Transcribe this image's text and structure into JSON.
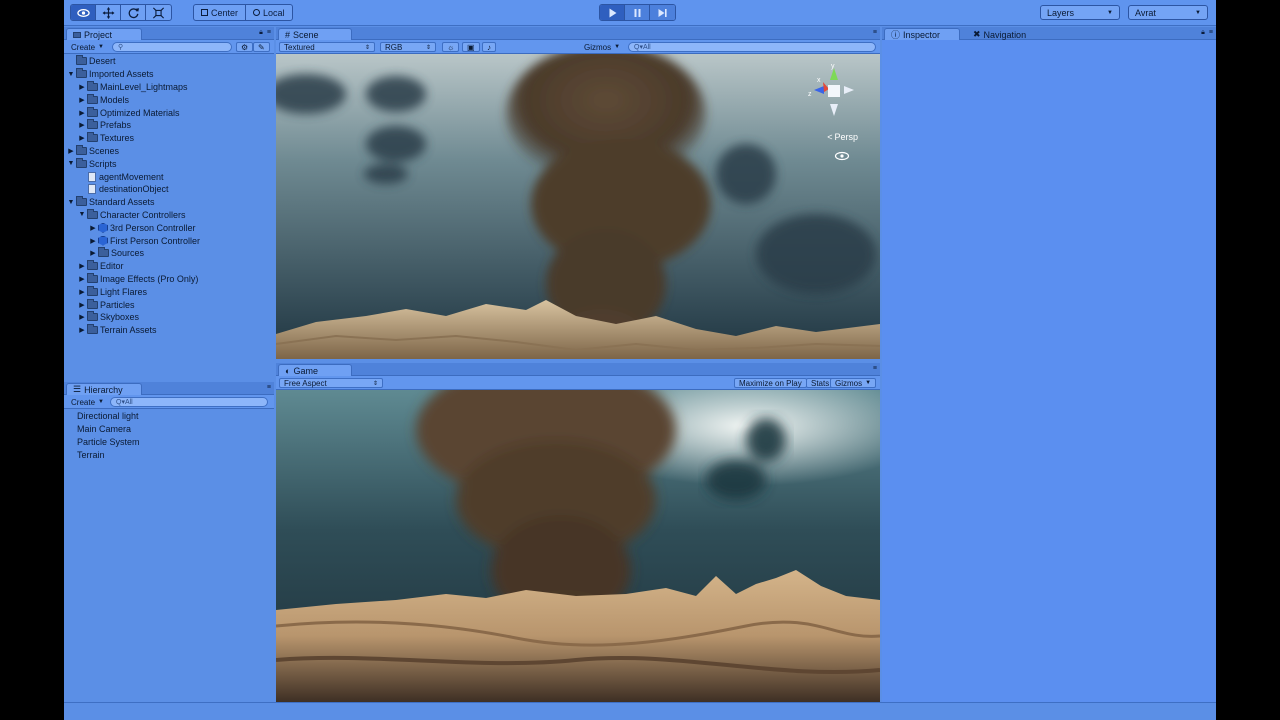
{
  "toolbar": {
    "pivot_center": "Center",
    "pivot_local": "Local",
    "layers": "Layers",
    "layout": "Avrat"
  },
  "project": {
    "tab": "Project",
    "create": "Create",
    "items": [
      {
        "label": "Desert",
        "depth": 0,
        "expand": "",
        "icon": "folder"
      },
      {
        "label": "Imported Assets",
        "depth": 0,
        "expand": "open",
        "icon": "folder"
      },
      {
        "label": "MainLevel_Lightmaps",
        "depth": 1,
        "expand": "closed",
        "icon": "folder"
      },
      {
        "label": "Models",
        "depth": 1,
        "expand": "closed",
        "icon": "folder"
      },
      {
        "label": "Optimized Materials",
        "depth": 1,
        "expand": "closed",
        "icon": "folder"
      },
      {
        "label": "Prefabs",
        "depth": 1,
        "expand": "closed",
        "icon": "folder"
      },
      {
        "label": "Textures",
        "depth": 1,
        "expand": "closed",
        "icon": "folder"
      },
      {
        "label": "Scenes",
        "depth": 0,
        "expand": "closed",
        "icon": "folder"
      },
      {
        "label": "Scripts",
        "depth": 0,
        "expand": "open",
        "icon": "folder"
      },
      {
        "label": "agentMovement",
        "depth": 1,
        "expand": "",
        "icon": "file"
      },
      {
        "label": "destinationObject",
        "depth": 1,
        "expand": "",
        "icon": "file"
      },
      {
        "label": "Standard Assets",
        "depth": 0,
        "expand": "open",
        "icon": "folder"
      },
      {
        "label": "Character Controllers",
        "depth": 1,
        "expand": "open",
        "icon": "folder"
      },
      {
        "label": "3rd Person Controller",
        "depth": 2,
        "expand": "closed",
        "icon": "cube"
      },
      {
        "label": "First Person Controller",
        "depth": 2,
        "expand": "closed",
        "icon": "cube"
      },
      {
        "label": "Sources",
        "depth": 2,
        "expand": "closed",
        "icon": "folder"
      },
      {
        "label": "Editor",
        "depth": 1,
        "expand": "closed",
        "icon": "folder"
      },
      {
        "label": "Image Effects (Pro Only)",
        "depth": 1,
        "expand": "closed",
        "icon": "folder"
      },
      {
        "label": "Light Flares",
        "depth": 1,
        "expand": "closed",
        "icon": "folder"
      },
      {
        "label": "Particles",
        "depth": 1,
        "expand": "closed",
        "icon": "folder"
      },
      {
        "label": "Skyboxes",
        "depth": 1,
        "expand": "closed",
        "icon": "folder"
      },
      {
        "label": "Terrain Assets",
        "depth": 1,
        "expand": "closed",
        "icon": "folder"
      }
    ]
  },
  "hierarchy": {
    "tab": "Hierarchy",
    "create": "Create",
    "search_placeholder": "Q▾All",
    "items": [
      "Directional light",
      "Main Camera",
      "Particle System",
      "Terrain"
    ]
  },
  "scene": {
    "tab": "Scene",
    "render_mode": "Textured",
    "channel": "RGB",
    "gizmos": "Gizmos",
    "search_placeholder": "Q▾All",
    "persp": "Persp",
    "axis_y": "y",
    "axis_x": "x",
    "axis_z": "z"
  },
  "game": {
    "tab": "Game",
    "aspect": "Free Aspect",
    "maximize": "Maximize on Play",
    "stats": "Stats",
    "gizmos": "Gizmos"
  },
  "inspector": {
    "tab": "Inspector",
    "nav_tab": "Navigation"
  }
}
